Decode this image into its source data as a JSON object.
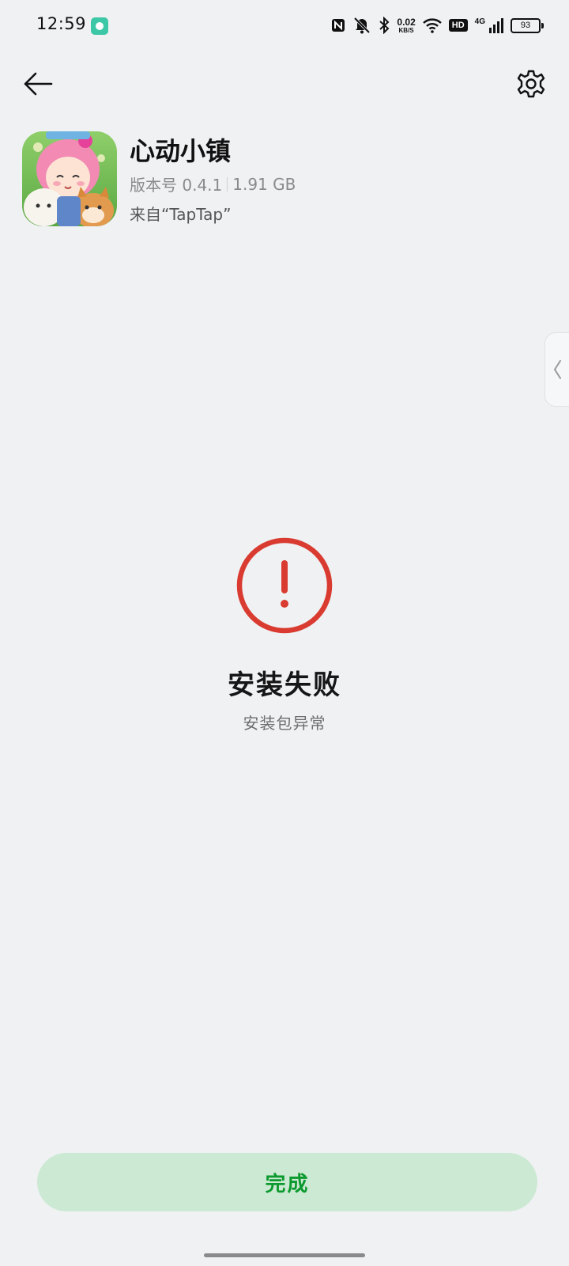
{
  "status_bar": {
    "time": "12:59",
    "net_speed_value": "0.02",
    "net_speed_unit": "KB/S",
    "hd_label": "HD",
    "network_type": "4G",
    "battery_level": "93"
  },
  "header": {
    "back_icon": "arrow-left-icon",
    "settings_icon": "gear-icon"
  },
  "app": {
    "name": "心动小镇",
    "version_label": "版本号 0.4.1",
    "size": "1.91 GB",
    "source": "来自“TapTap”"
  },
  "result": {
    "status_icon": "error-exclamation-icon",
    "status_color": "#d93b30",
    "title": "安装失败",
    "subtitle": "安装包异常"
  },
  "actions": {
    "done_label": "完成",
    "done_color": "#0c9a2e",
    "done_bg": "#cce9d3"
  }
}
